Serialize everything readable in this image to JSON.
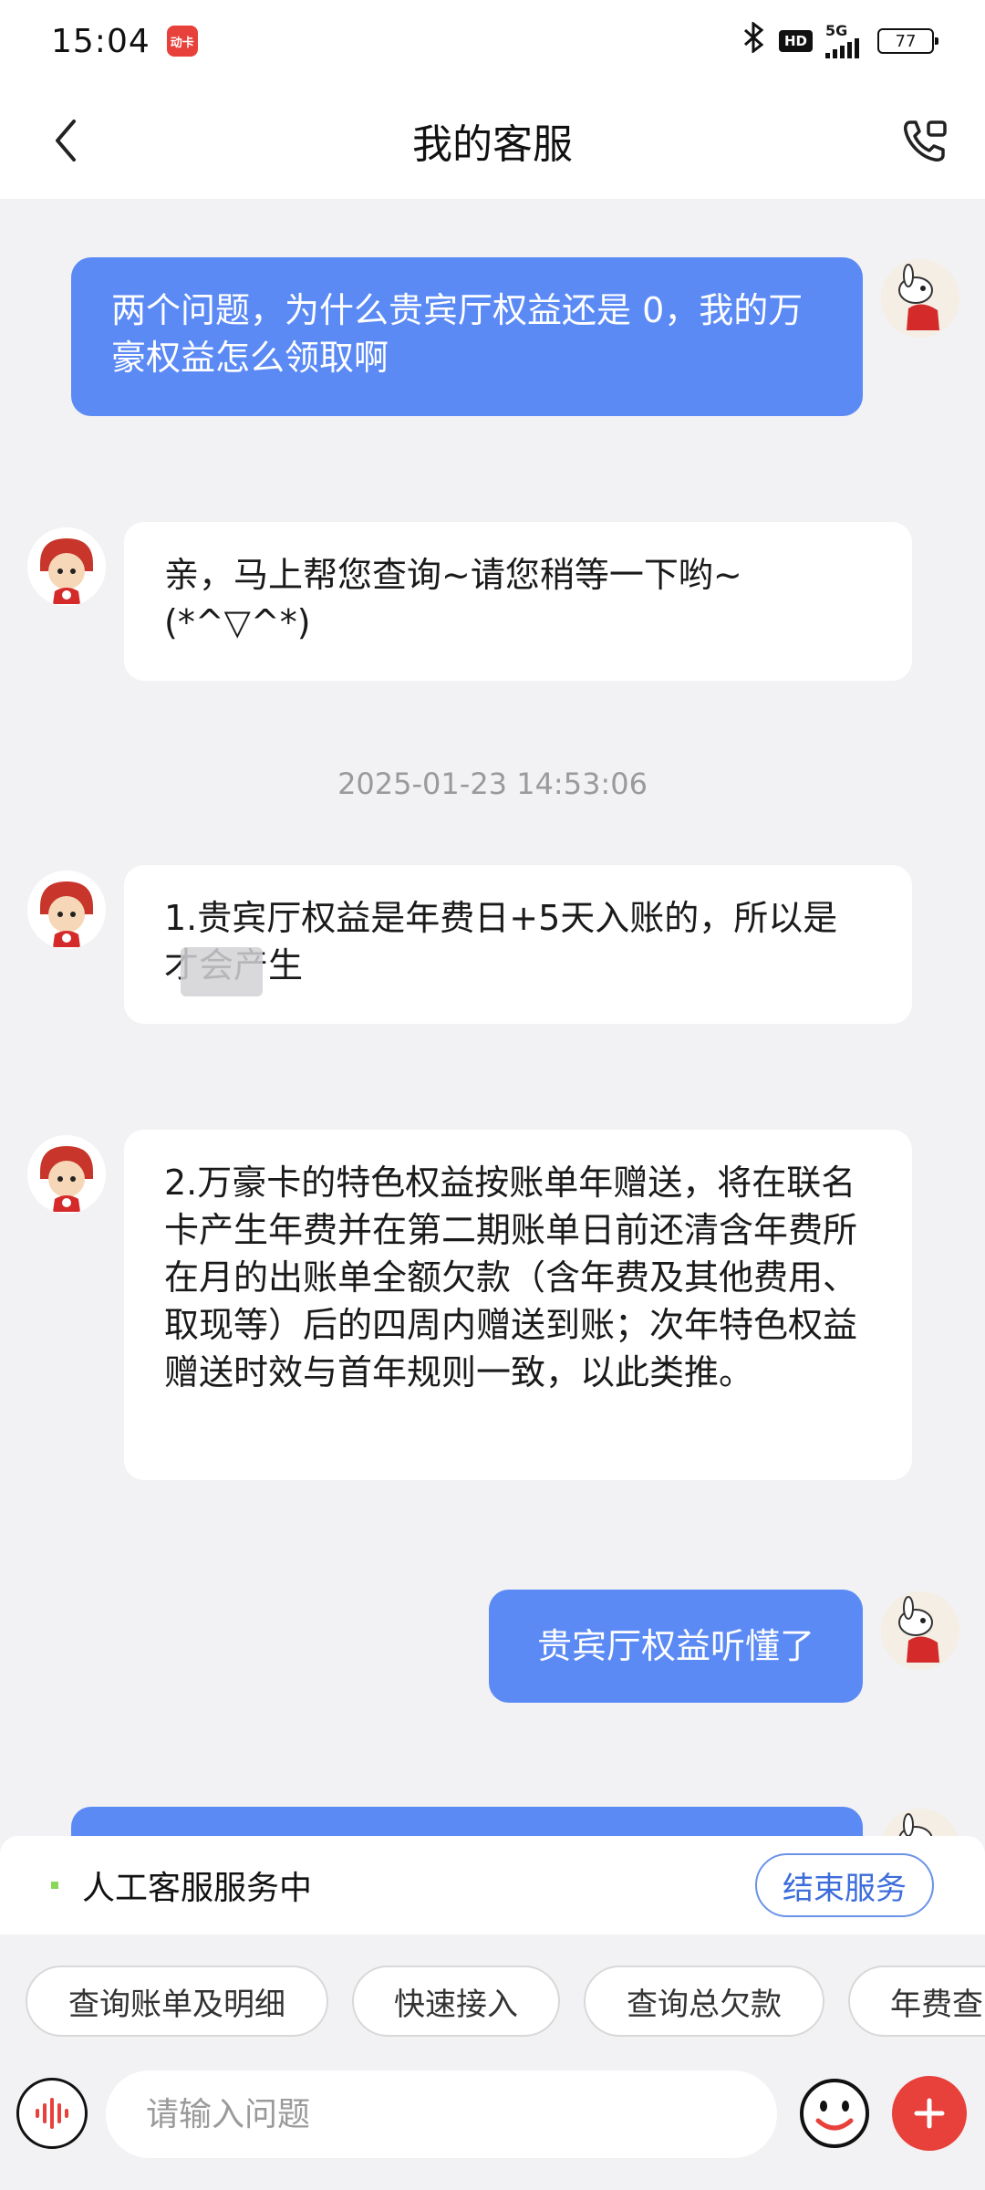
{
  "status_bar": {
    "time": "15:04",
    "app_badge": "动卡",
    "hd": "HD",
    "network": "5G",
    "battery": "77"
  },
  "header": {
    "title": "我的客服"
  },
  "messages": [
    {
      "role": "user",
      "text": "两个问题，为什么贵宾厅权益还是 0，我的万豪权益怎么领取啊"
    },
    {
      "role": "agent",
      "text": "亲，马上帮您查询~请您稍等一下哟~ (*^▽^*)"
    },
    {
      "role": "timestamp",
      "text": "2025-01-23 14:53:06"
    },
    {
      "role": "agent",
      "text": "1.贵宾厅权益是年费日+5天入账的，所以是 才会产生"
    },
    {
      "role": "agent",
      "text": "2.万豪卡的特色权益按账单年赠送，将在联名卡产生年费并在第二期账单日前还清含年费所在月的出账单全额欠款（含年费及其他费用、取现等）后的四周内赠送到账；次年特色权益赠送时效与首年规则一致，以此类推。"
    },
    {
      "role": "user",
      "text": "贵宾厅权益听懂了"
    }
  ],
  "service_bar": {
    "status": "人工客服服务中",
    "end_label": "结束服务"
  },
  "quick_replies": [
    "查询账单及明细",
    "快速接入",
    "查询总欠款",
    "年费查"
  ],
  "input": {
    "placeholder": "请输入问题"
  },
  "colors": {
    "user_bubble": "#5b8af5",
    "plus_button": "#e8403a",
    "end_button": "#3d6ddb"
  },
  "icons": {
    "back": "back-arrow-icon",
    "call": "phone-call-icon",
    "voice": "voice-wave-icon",
    "emoji": "smiley-icon",
    "plus": "plus-icon"
  }
}
